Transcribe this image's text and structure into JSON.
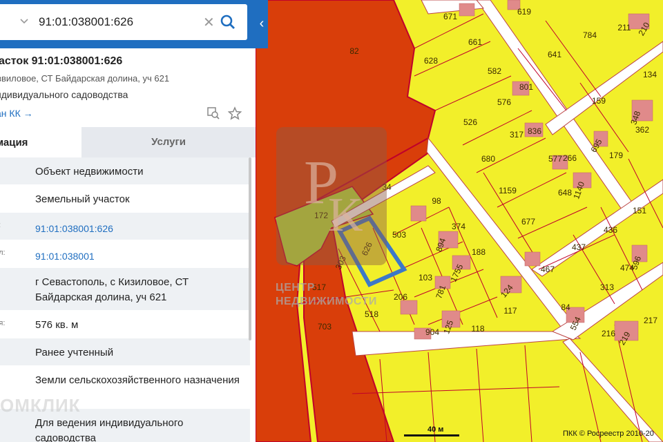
{
  "search": {
    "value": "91:01:038001:626"
  },
  "object": {
    "title": "асток 91:01:038001:626",
    "subtitle": "звиловое, СТ Байдарская долина, уч 621",
    "usage": "ндивидуального садоводства",
    "plan_link": "ан КК →"
  },
  "tabs": {
    "info": "мация",
    "services": "Услуги"
  },
  "rows": [
    {
      "label": "",
      "value": "Объект недвижимости"
    },
    {
      "label": "",
      "value": "Земельный участок"
    },
    {
      "label": "р:",
      "value": "91:01:038001:626"
    },
    {
      "label": "ал:",
      "value": "91:01:038001"
    },
    {
      "label": "",
      "value": "г Севастополь, с Кизиловое, СТ Байдарская долина, уч 621"
    },
    {
      "label": "дя:",
      "value": "576 кв. м"
    },
    {
      "label": "",
      "value": "Ранее учтенный"
    },
    {
      "label": "",
      "value": "Земли сельскохозяйственного назначения"
    },
    {
      "label": "",
      "value": "Для ведения индивидуального садоводства"
    }
  ],
  "map": {
    "parcel_labels": [
      "82",
      "671",
      "661",
      "628",
      "582",
      "576",
      "619",
      "784",
      "211",
      "210",
      "641",
      "134",
      "801",
      "159",
      "526",
      "317",
      "836",
      "348",
      "362",
      "695",
      "179",
      "680",
      "577",
      "266",
      "1159",
      "648",
      "1140",
      "98",
      "374",
      "677",
      "151",
      "172",
      "34",
      "503",
      "626",
      "436",
      "894",
      "188",
      "303",
      "437",
      "474",
      "596",
      "467",
      "1755",
      "313",
      "517",
      "103",
      "781",
      "124",
      "117",
      "84",
      "554",
      "206",
      "118",
      "904",
      "125",
      "703",
      "518",
      "217",
      "216",
      "219"
    ],
    "selected_parcel": "626",
    "scale_label": "40 м",
    "copyright": "ПКК © Росреестр 2010-20"
  },
  "watermarks": {
    "center": "ЦЕНТР\nНЕДВИЖИМОСТИ",
    "domclick": "ОМКЛИК"
  },
  "colors": {
    "accent": "#1f6ec0",
    "parcel_fill": "#f2ef2a",
    "boundary": "#c0002a",
    "orange_zone": "#d93e0a",
    "highlight": "#3c78c8",
    "green_zone": "#b6e23a"
  }
}
